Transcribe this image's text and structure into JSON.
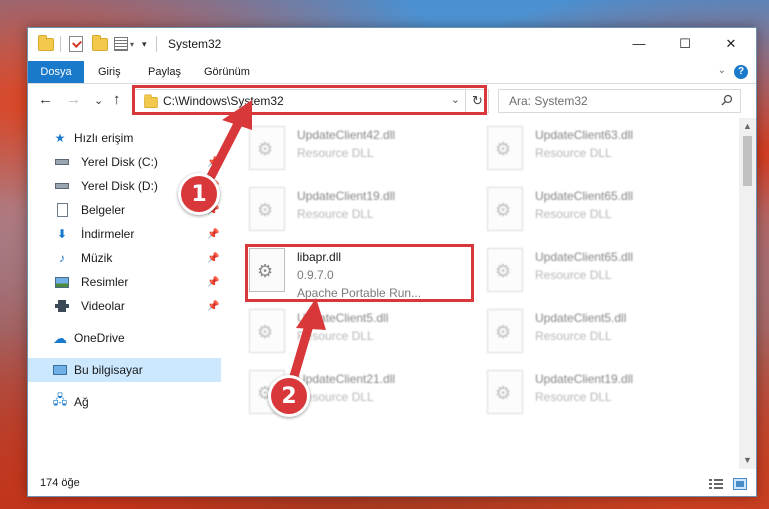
{
  "window": {
    "title": "System32",
    "controls": {
      "minimize": "—",
      "maximize": "☐",
      "close": "✕"
    }
  },
  "ribbon": {
    "tabs": [
      "Dosya",
      "Giriş",
      "Paylaş",
      "Görünüm"
    ],
    "help": "?",
    "collapse": "⌄"
  },
  "nav": {
    "back": "←",
    "forward": "→",
    "recent": "⌄",
    "up": "↑",
    "address": "C:\\Windows\\System32",
    "address_dropdown": "⌄",
    "refresh": "↻",
    "search_placeholder": "Ara: System32"
  },
  "sidebar": {
    "quick_access": "Hızlı erişim",
    "items": [
      {
        "label": "Yerel Disk (C:)",
        "icon": "drive-icon",
        "pinned": true
      },
      {
        "label": "Yerel Disk (D:)",
        "icon": "drive-icon",
        "pinned": true
      },
      {
        "label": "Belgeler",
        "icon": "documents-icon",
        "pinned": true
      },
      {
        "label": "İndirmeler",
        "icon": "downloads-icon",
        "pinned": true
      },
      {
        "label": "Müzik",
        "icon": "music-icon",
        "pinned": true
      },
      {
        "label": "Resimler",
        "icon": "pictures-icon",
        "pinned": true
      },
      {
        "label": "Videolar",
        "icon": "videos-icon",
        "pinned": true
      }
    ],
    "onedrive": "OneDrive",
    "this_pc": "Bu bilgisayar",
    "network": "Ağ"
  },
  "files": [
    {
      "name": "UpdateClient42.dll",
      "sub": "Resource DLL",
      "blurred": true
    },
    {
      "name": "UpdateClient63.dll",
      "sub": "Resource DLL",
      "blurred": true
    },
    {
      "name": "UpdateClient19.dll",
      "sub": "Resource DLL",
      "blurred": true
    },
    {
      "name": "UpdateClient65.dll",
      "sub": "Resource DLL",
      "blurred": true
    },
    {
      "name": "libapr.dll",
      "sub": "0.9.7.0",
      "sub2": "Apache Portable Run...",
      "blurred": false
    },
    {
      "name": "UpdateClient65.dll",
      "sub": "Resource DLL",
      "blurred": true
    },
    {
      "name": "UpdateClient5.dll",
      "sub": "Resource DLL",
      "blurred": true
    },
    {
      "name": "UpdateClient5.dll",
      "sub": "Resource DLL",
      "blurred": true
    },
    {
      "name": "UpdateClient21.dll",
      "sub": "Resource DLL",
      "blurred": true
    },
    {
      "name": "UpdateClient19.dll",
      "sub": "Resource DLL",
      "blurred": true
    }
  ],
  "status": {
    "count": "174 öğe"
  },
  "annotations": {
    "step1": "1",
    "step2": "2",
    "highlight_color": "#d9383a"
  }
}
